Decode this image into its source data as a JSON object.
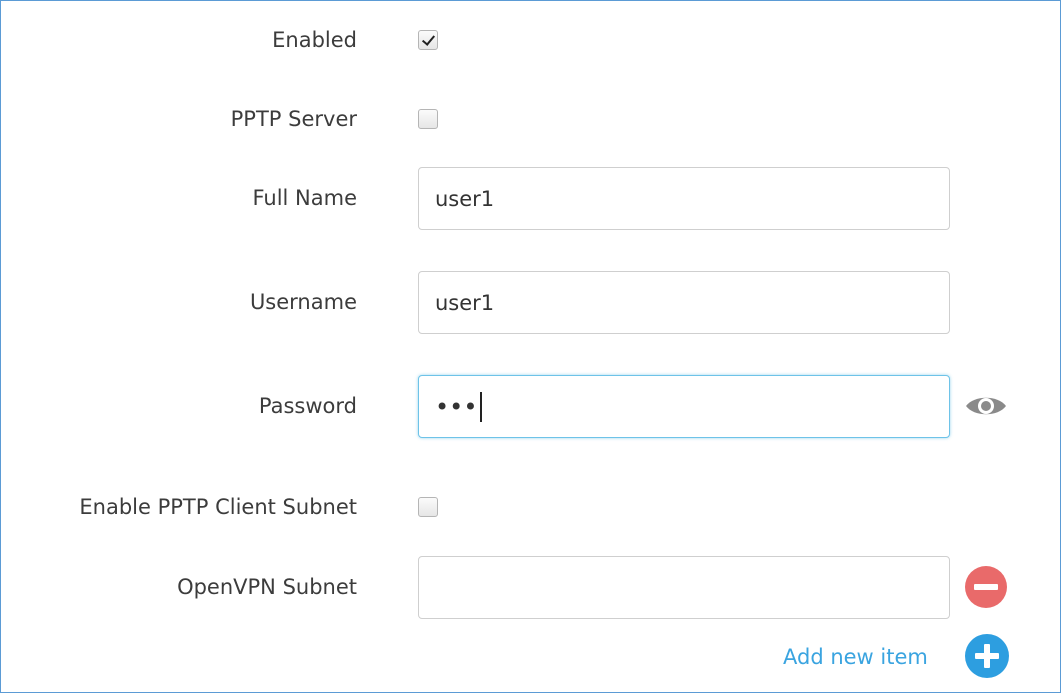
{
  "form": {
    "enabled": {
      "label": "Enabled",
      "checked": true
    },
    "pptp_server": {
      "label": "PPTP Server",
      "checked": false
    },
    "full_name": {
      "label": "Full Name",
      "value": "user1"
    },
    "username": {
      "label": "Username",
      "value": "user1"
    },
    "password": {
      "label": "Password",
      "masked_value": "•••",
      "icon": "eye-icon"
    },
    "enable_pptp_client_subnet": {
      "label": "Enable PPTP Client Subnet",
      "checked": false
    },
    "openvpn_subnet": {
      "label": "OpenVPN Subnet",
      "value": "",
      "remove_icon": "minus-circle-icon"
    },
    "add_new_item": {
      "label": "Add new item",
      "icon": "plus-circle-icon"
    }
  },
  "colors": {
    "frame_border": "#5b9bd5",
    "focus_border": "#6ec3e8",
    "remove_red": "#e96a6a",
    "add_blue": "#2d9ee0",
    "link_blue": "#3aa4e0",
    "eye_gray": "#8a8a8a"
  }
}
